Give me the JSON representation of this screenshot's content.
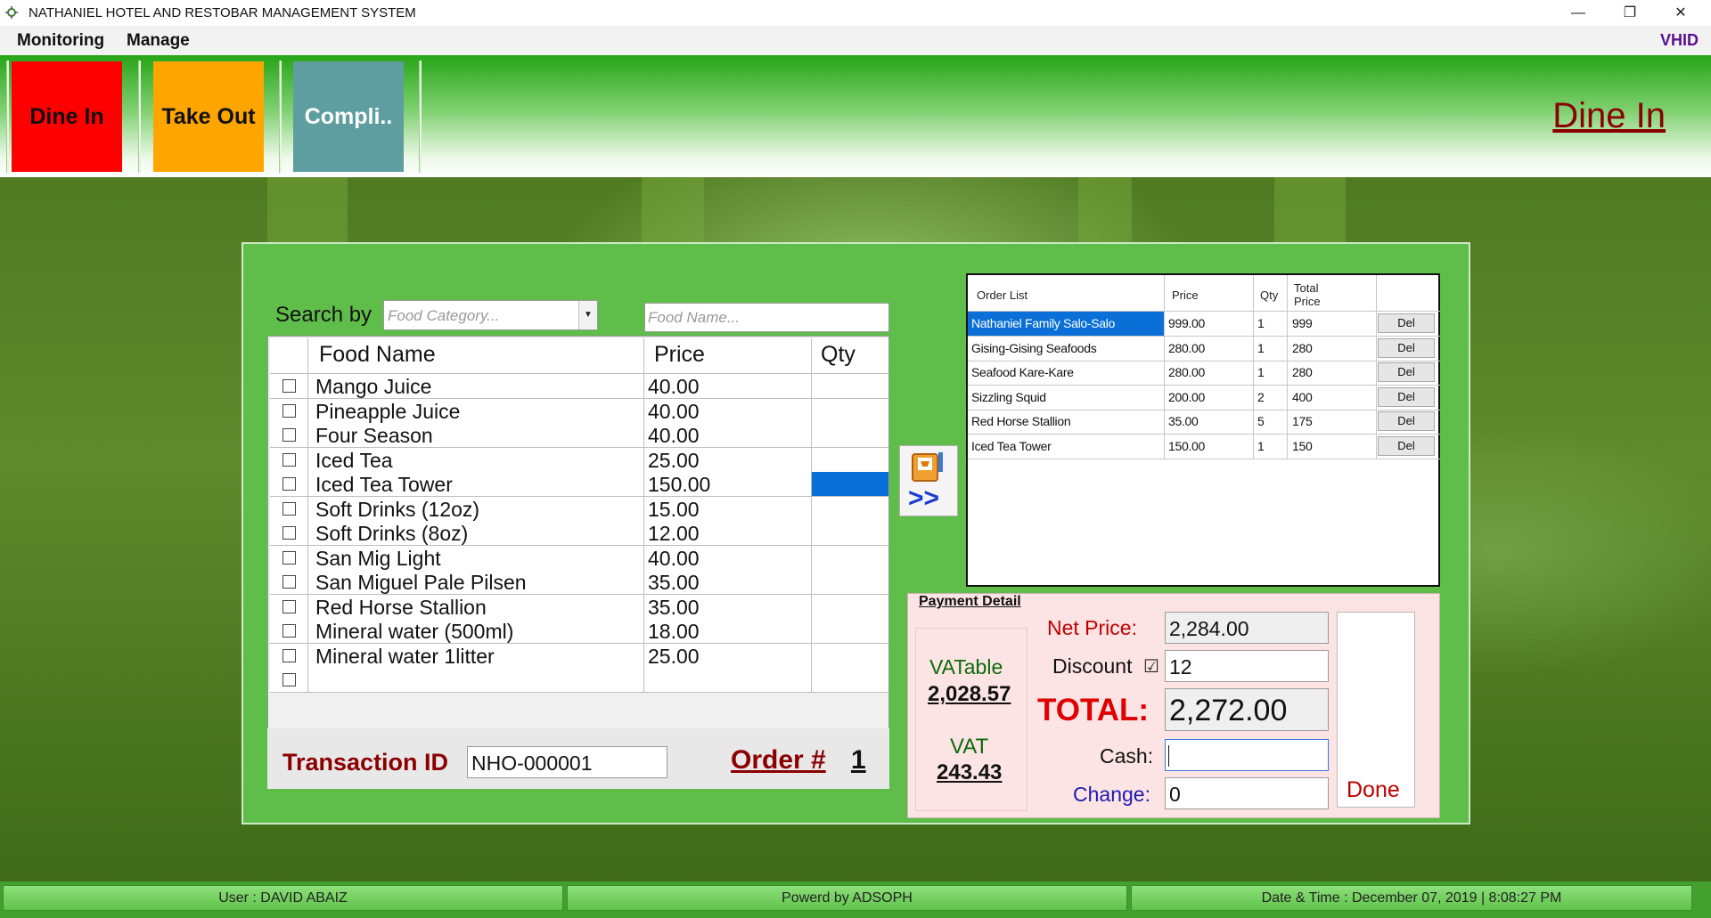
{
  "window": {
    "title": "NATHANIEL HOTEL AND RESTOBAR MANAGEMENT SYSTEM",
    "minimize": "—",
    "restore": "❐",
    "close": "✕"
  },
  "menu": {
    "items": [
      "Monitoring",
      "Manage"
    ],
    "user_tag": "VHID"
  },
  "toolbar": {
    "buttons": [
      {
        "label": "Dine In",
        "color": "#ff0000"
      },
      {
        "label": "Take Out",
        "color": "#ffa500"
      },
      {
        "label": "Compli..",
        "color": "#5f9ea0"
      }
    ],
    "mode_label": "Dine In"
  },
  "search": {
    "label": "Search by",
    "category_placeholder": "Food Category...",
    "name_placeholder": "Food Name..."
  },
  "food_table": {
    "headers": [
      "Food Name",
      "Price",
      "Qty"
    ],
    "rows": [
      {
        "name": "Mango Juice",
        "price": "40.00"
      },
      {
        "name": "Pineapple Juice",
        "price": "40.00"
      },
      {
        "name": "Four Season",
        "price": "40.00"
      },
      {
        "name": "Iced Tea",
        "price": "25.00"
      },
      {
        "name": "Iced Tea Tower",
        "price": "150.00"
      },
      {
        "name": "Soft Drinks (12oz)",
        "price": "15.00"
      },
      {
        "name": "Soft Drinks (8oz)",
        "price": "12.00"
      },
      {
        "name": "San Mig Light",
        "price": "40.00"
      },
      {
        "name": "San Miguel Pale Pilsen",
        "price": "35.00"
      },
      {
        "name": "Red Horse Stallion",
        "price": "35.00"
      },
      {
        "name": "Mineral water (500ml)",
        "price": "18.00"
      },
      {
        "name": "Mineral water 1litter",
        "price": "25.00"
      },
      {
        "name": "",
        "price": ""
      }
    ]
  },
  "transaction": {
    "label": "Transaction ID",
    "id": "NHO-000001",
    "order_label": "Order #",
    "order_no": "1"
  },
  "add_button": {
    "label": ">>",
    "icon": "cart-icon"
  },
  "order_table": {
    "headers": {
      "name": "Order List",
      "price": "Price",
      "qty": "Qty",
      "total_line1": "Total",
      "total_line2": "Price"
    },
    "rows": [
      {
        "name": "Nathaniel Family Salo-Salo",
        "price": "999.00",
        "qty": "1",
        "total": "999",
        "del": "Del"
      },
      {
        "name": "Gising-Gising Seafoods",
        "price": "280.00",
        "qty": "1",
        "total": "280",
        "del": "Del"
      },
      {
        "name": "Seafood Kare-Kare",
        "price": "280.00",
        "qty": "1",
        "total": "280",
        "del": "Del"
      },
      {
        "name": "Sizzling Squid",
        "price": "200.00",
        "qty": "2",
        "total": "400",
        "del": "Del"
      },
      {
        "name": "Red Horse Stallion",
        "price": "35.00",
        "qty": "5",
        "total": "175",
        "del": "Del"
      },
      {
        "name": "Iced Tea Tower",
        "price": "150.00",
        "qty": "1",
        "total": "150",
        "del": "Del"
      }
    ]
  },
  "payment": {
    "title": "Payment Detail",
    "vatable_label": "VATable",
    "vatable_value": "2,028.57",
    "vat_label": "VAT",
    "vat_value": "243.43",
    "net_price_label": "Net Price:",
    "net_price": "2,284.00",
    "discount_label": "Discount",
    "discount_check": "☑",
    "discount": "12",
    "total_label": "TOTAL:",
    "total": "2,272.00",
    "cash_label": "Cash:",
    "cash": "",
    "change_label": "Change:",
    "change": "0",
    "done_label": "Done"
  },
  "status": {
    "user": "User :   DAVID ABAIZ",
    "powered": "Powerd by ADSOPH",
    "datetime": "Date & Time : December 07, 2019  |  8:08:27 PM"
  }
}
